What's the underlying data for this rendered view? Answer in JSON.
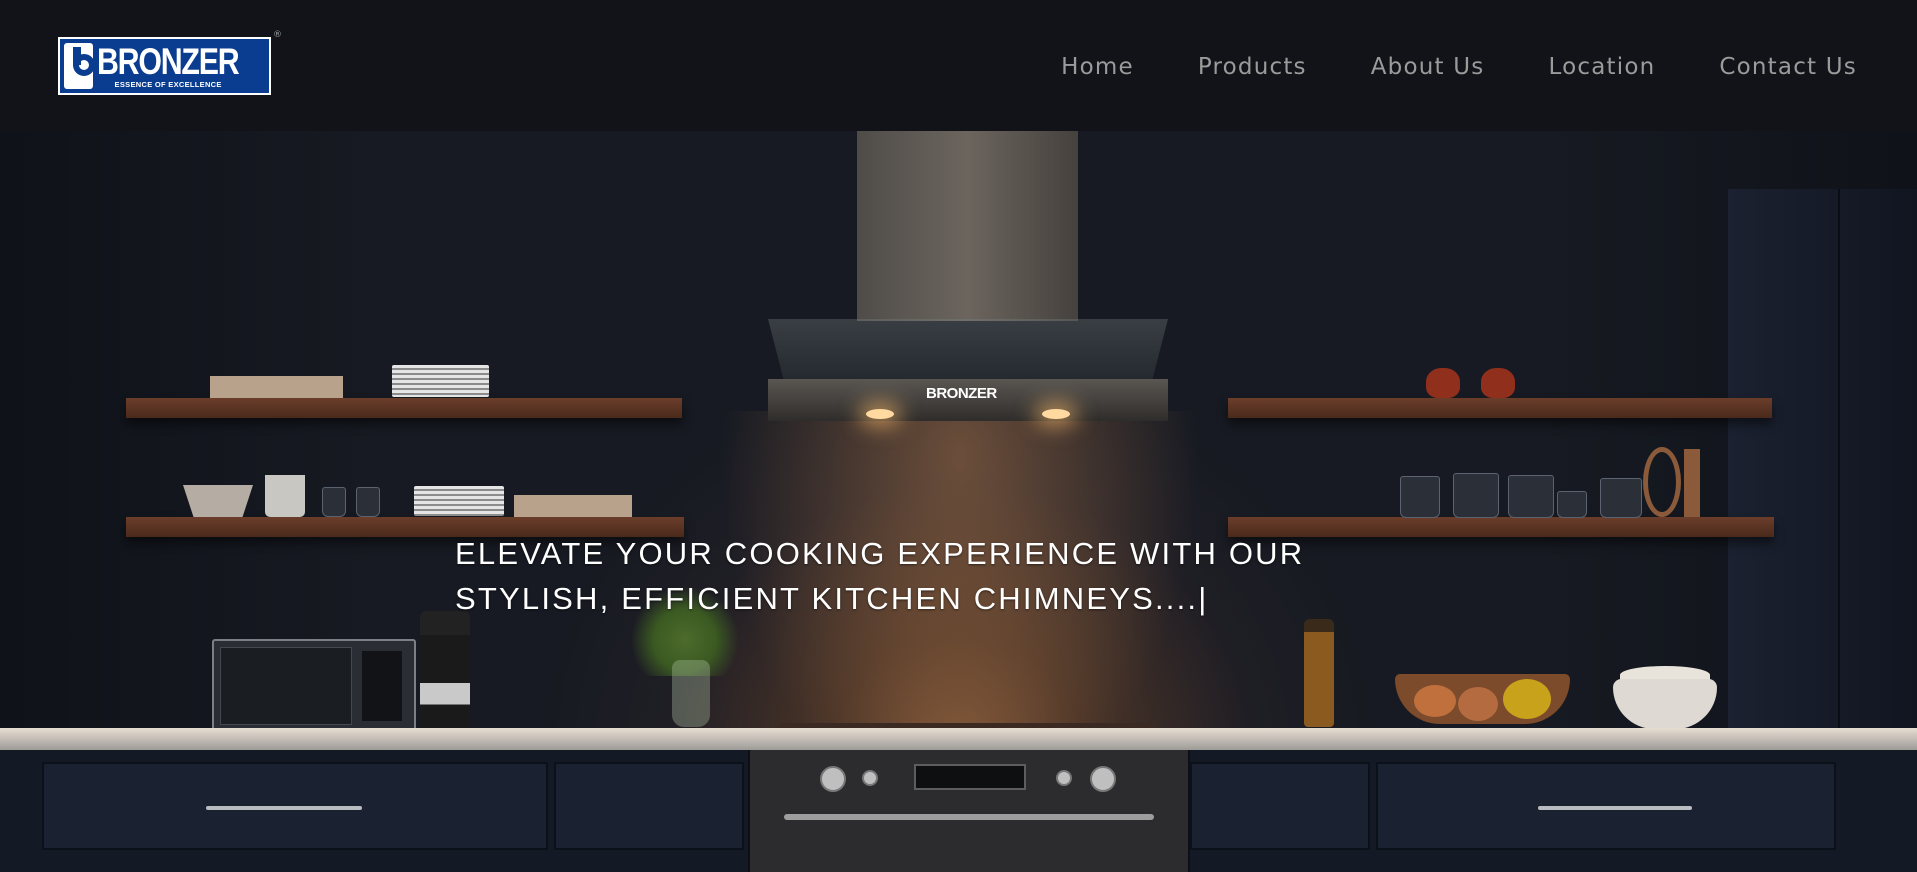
{
  "brand": {
    "name": "BRONZER",
    "tagline": "ESSENCE OF EXCELLENCE",
    "registered_mark": "®",
    "primary_color": "#0a3d8f"
  },
  "nav": {
    "items": [
      {
        "label": "Home"
      },
      {
        "label": "Products"
      },
      {
        "label": "About Us"
      },
      {
        "label": "Location"
      },
      {
        "label": "Contact Us"
      }
    ]
  },
  "hero": {
    "headline_line1": "ELEVATE YOUR COOKING EXPERIENCE WITH OUR",
    "headline_line2": "STYLISH, EFFICIENT KITCHEN CHIMNEYS....|",
    "hood_brand": "BRONZER"
  },
  "colors": {
    "header_bg": "#111318",
    "nav_text": "#9b9b9b",
    "headline_text": "#ffffff"
  }
}
